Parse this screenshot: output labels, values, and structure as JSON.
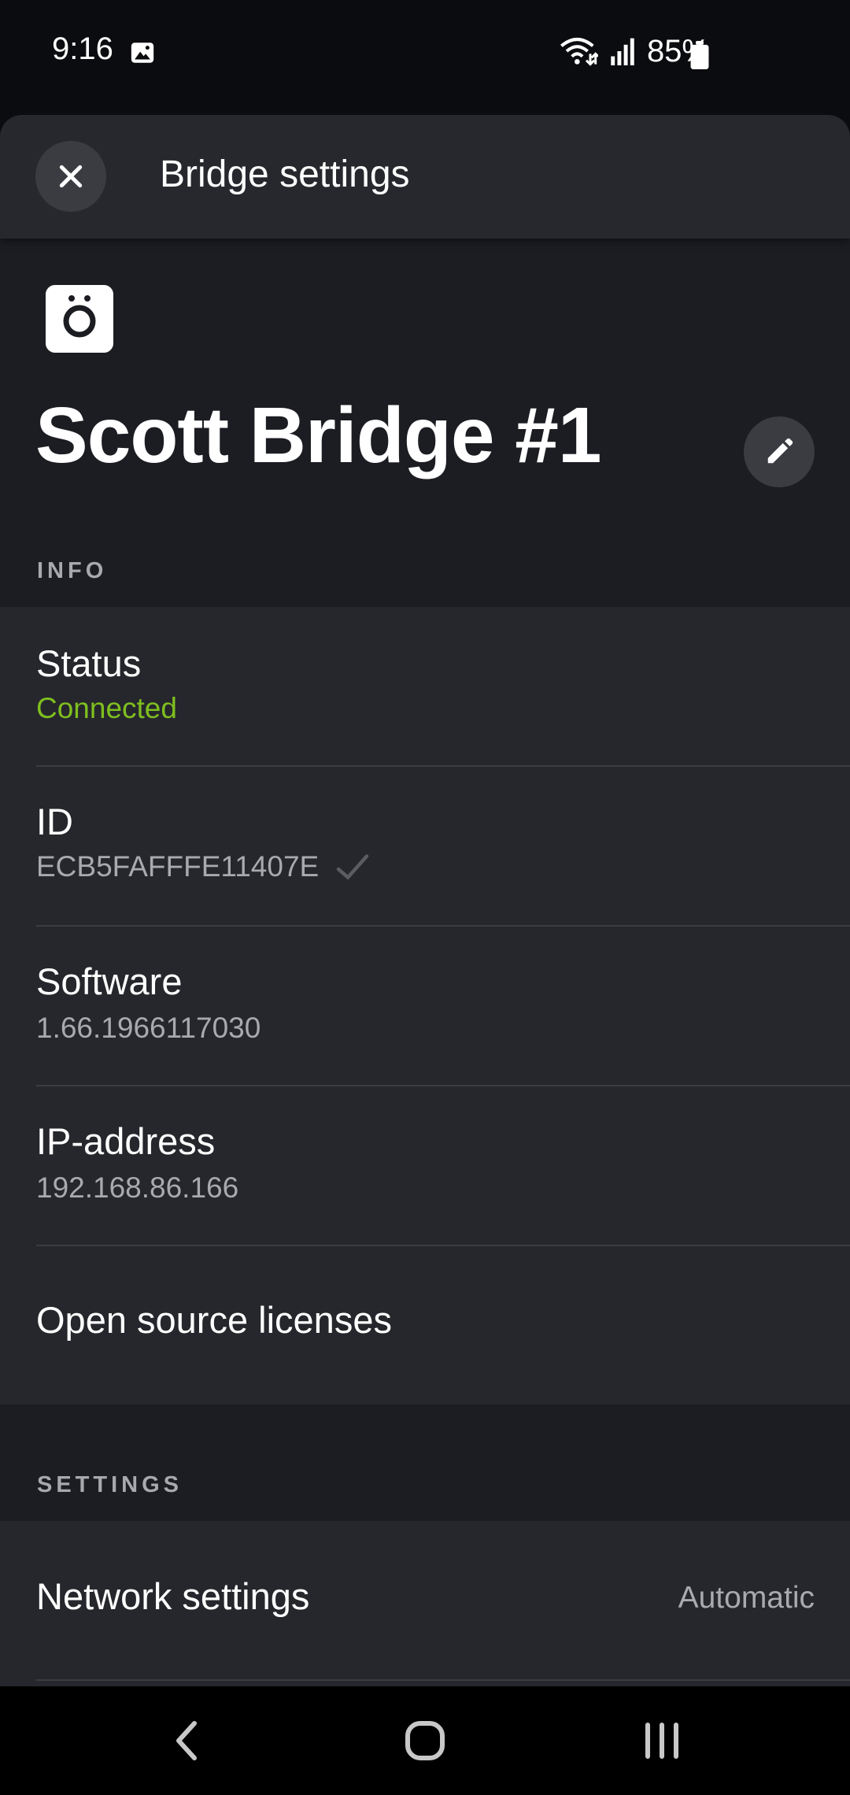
{
  "status_bar": {
    "time": "9:16",
    "battery": "85%",
    "icons": [
      "gallery-icon",
      "wifi-icon",
      "signal-icon",
      "battery-icon"
    ]
  },
  "header": {
    "title": "Bridge settings",
    "close_icon": "close-icon"
  },
  "bridge": {
    "icon": "bridge-device-icon",
    "name": "Scott Bridge #1",
    "edit_icon": "pencil-icon"
  },
  "info": {
    "section_label": "INFO",
    "status": {
      "label": "Status",
      "value": "Connected"
    },
    "id": {
      "label": "ID",
      "value": "ECB5FAFFFE11407E"
    },
    "software": {
      "label": "Software",
      "value": "1.66.1966117030"
    },
    "ip": {
      "label": "IP-address",
      "value": "192.168.86.166"
    },
    "licenses": {
      "label": "Open source licenses"
    }
  },
  "settings": {
    "section_label": "SETTINGS",
    "network": {
      "label": "Network settings",
      "value": "Automatic"
    }
  },
  "nav": {
    "icons": [
      "back-icon",
      "home-icon",
      "recents-icon"
    ]
  },
  "colors": {
    "connected": "#7fbf1f",
    "background": "#1b1d22",
    "card": "#26272c"
  }
}
